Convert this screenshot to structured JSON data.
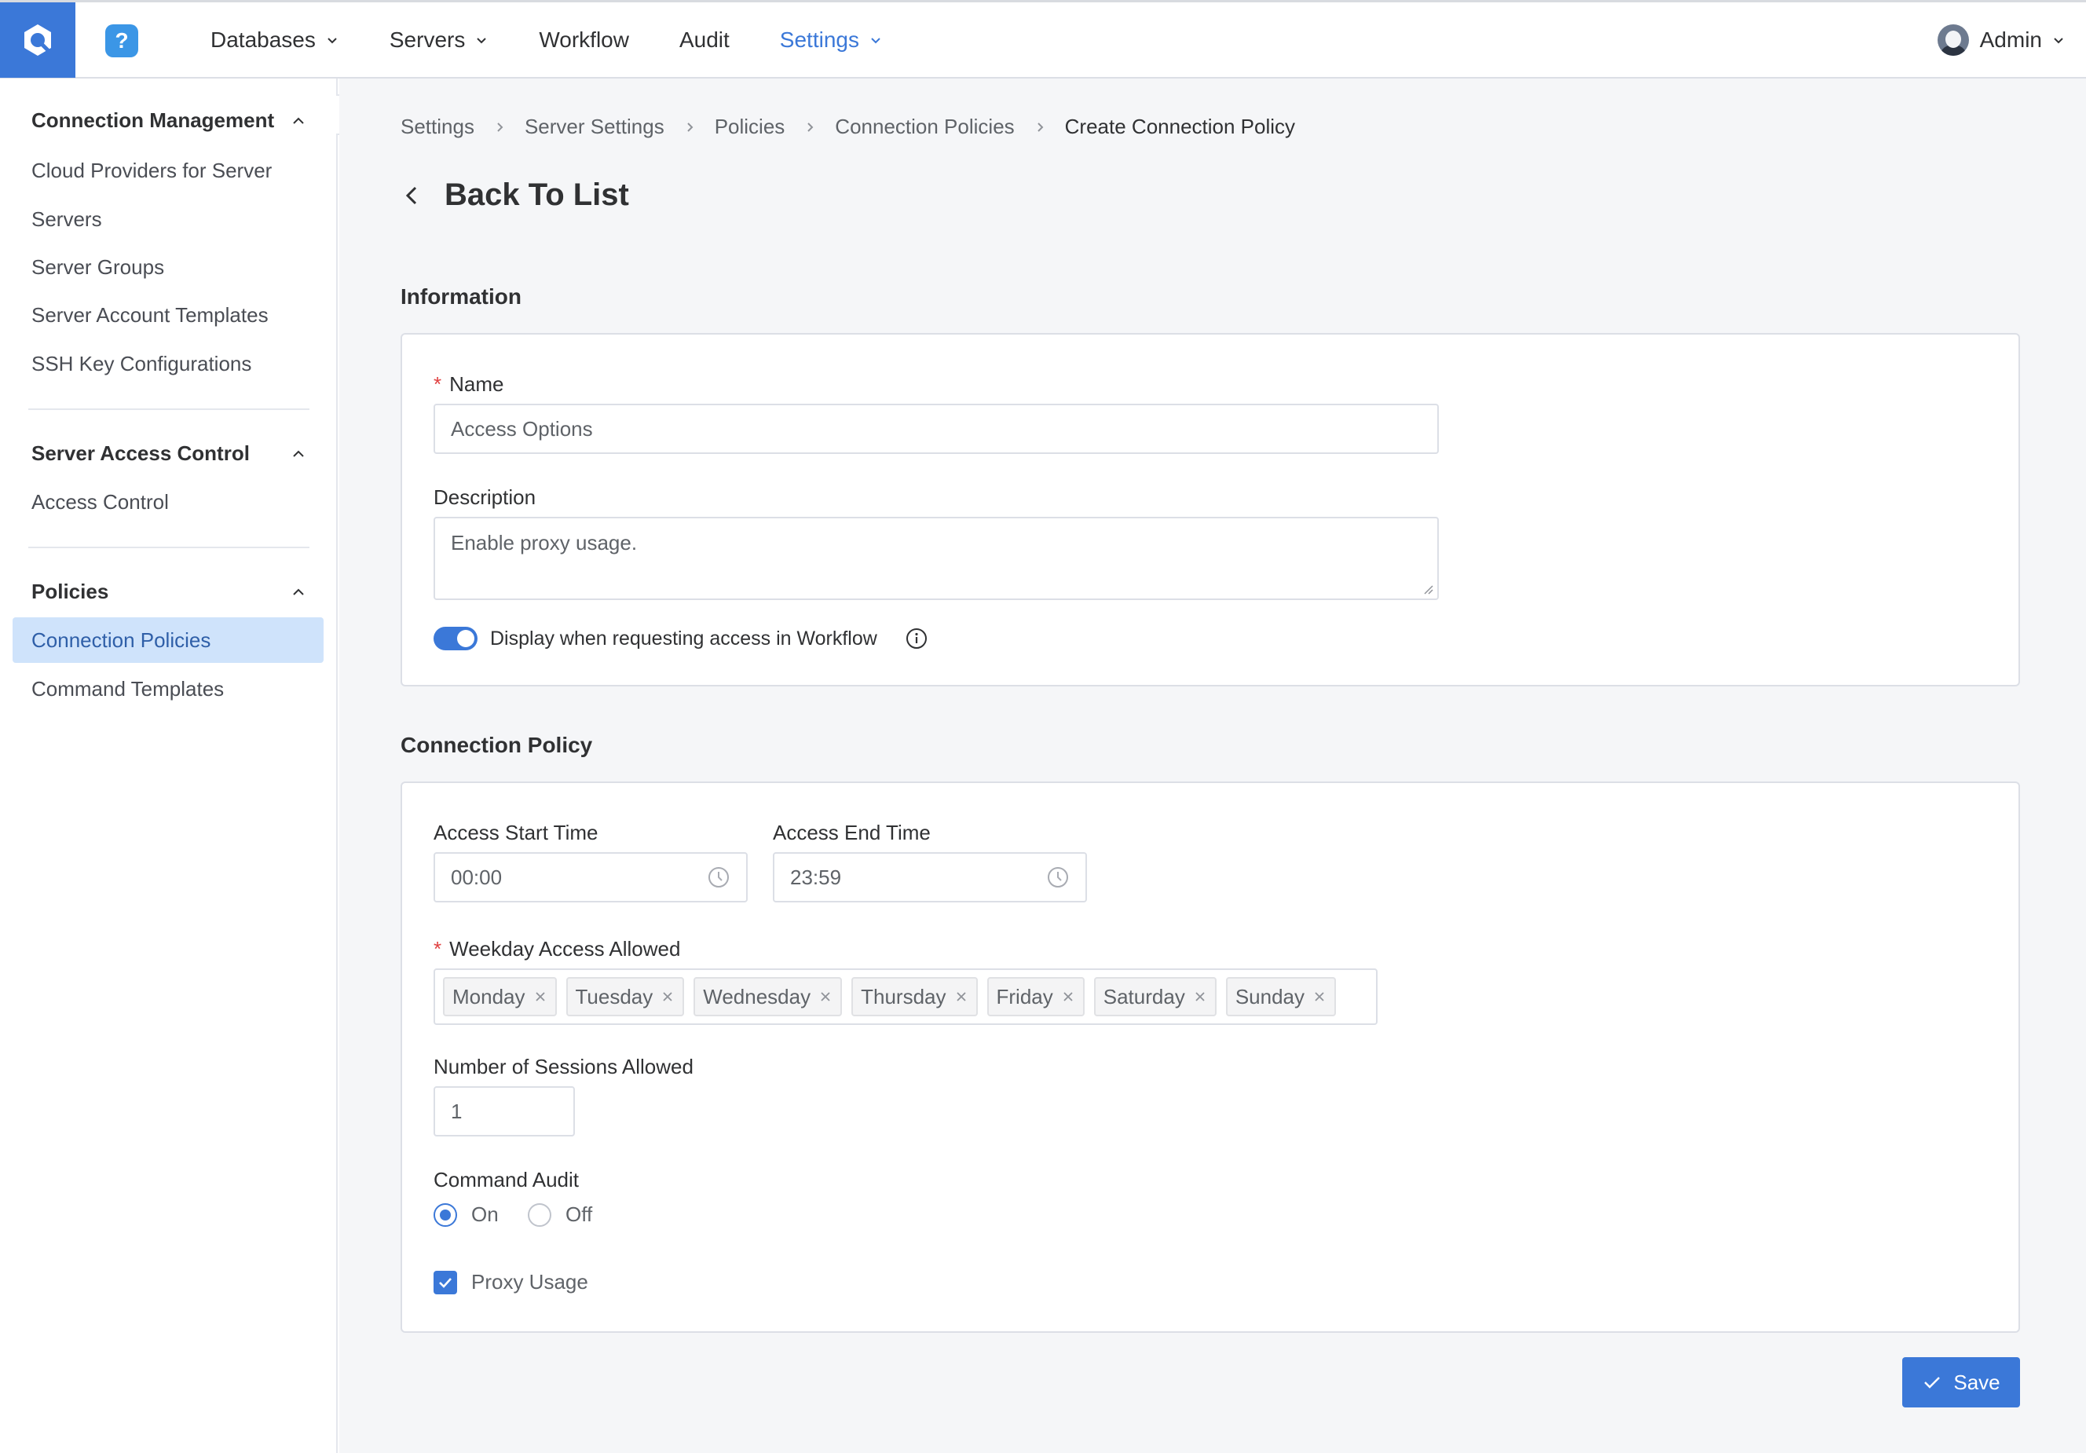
{
  "nav": {
    "items": [
      {
        "label": "Databases",
        "has_dropdown": true,
        "active": false
      },
      {
        "label": "Servers",
        "has_dropdown": true,
        "active": false
      },
      {
        "label": "Workflow",
        "has_dropdown": false,
        "active": false
      },
      {
        "label": "Audit",
        "has_dropdown": false,
        "active": false
      },
      {
        "label": "Settings",
        "has_dropdown": true,
        "active": true
      }
    ],
    "user_name": "Admin",
    "help_glyph": "?"
  },
  "sidebar": {
    "sections": [
      {
        "title": "Connection Management",
        "items": [
          "Cloud Providers for Server",
          "Servers",
          "Server Groups",
          "Server Account Templates",
          "SSH Key Configurations"
        ]
      },
      {
        "title": "Server Access Control",
        "items": [
          "Access Control"
        ]
      },
      {
        "title": "Policies",
        "items": [
          "Connection Policies",
          "Command Templates"
        ]
      }
    ],
    "active_item": "Connection Policies"
  },
  "breadcrumb": [
    "Settings",
    "Server Settings",
    "Policies",
    "Connection Policies",
    "Create Connection Policy"
  ],
  "back_label": "Back To List",
  "information": {
    "title": "Information",
    "name_label": "Name",
    "name_value": "Access Options",
    "description_label": "Description",
    "description_value": "Enable proxy usage.",
    "toggle_label": "Display when requesting access in Workflow",
    "toggle_on": true
  },
  "policy": {
    "title": "Connection Policy",
    "start_label": "Access Start Time",
    "start_value": "00:00",
    "end_label": "Access End Time",
    "end_value": "23:59",
    "weekday_label": "Weekday Access Allowed",
    "weekdays": [
      "Monday",
      "Tuesday",
      "Wednesday",
      "Thursday",
      "Friday",
      "Saturday",
      "Sunday"
    ],
    "sessions_label": "Number of Sessions Allowed",
    "sessions_value": "1",
    "audit_label": "Command Audit",
    "audit_on": "On",
    "audit_off": "Off",
    "audit_selected": "On",
    "proxy_label": "Proxy Usage",
    "proxy_checked": true
  },
  "save_label": "Save",
  "colors": {
    "accent": "#3b78d8",
    "active_bg": "#cfe3fb",
    "required": "#e04040"
  }
}
